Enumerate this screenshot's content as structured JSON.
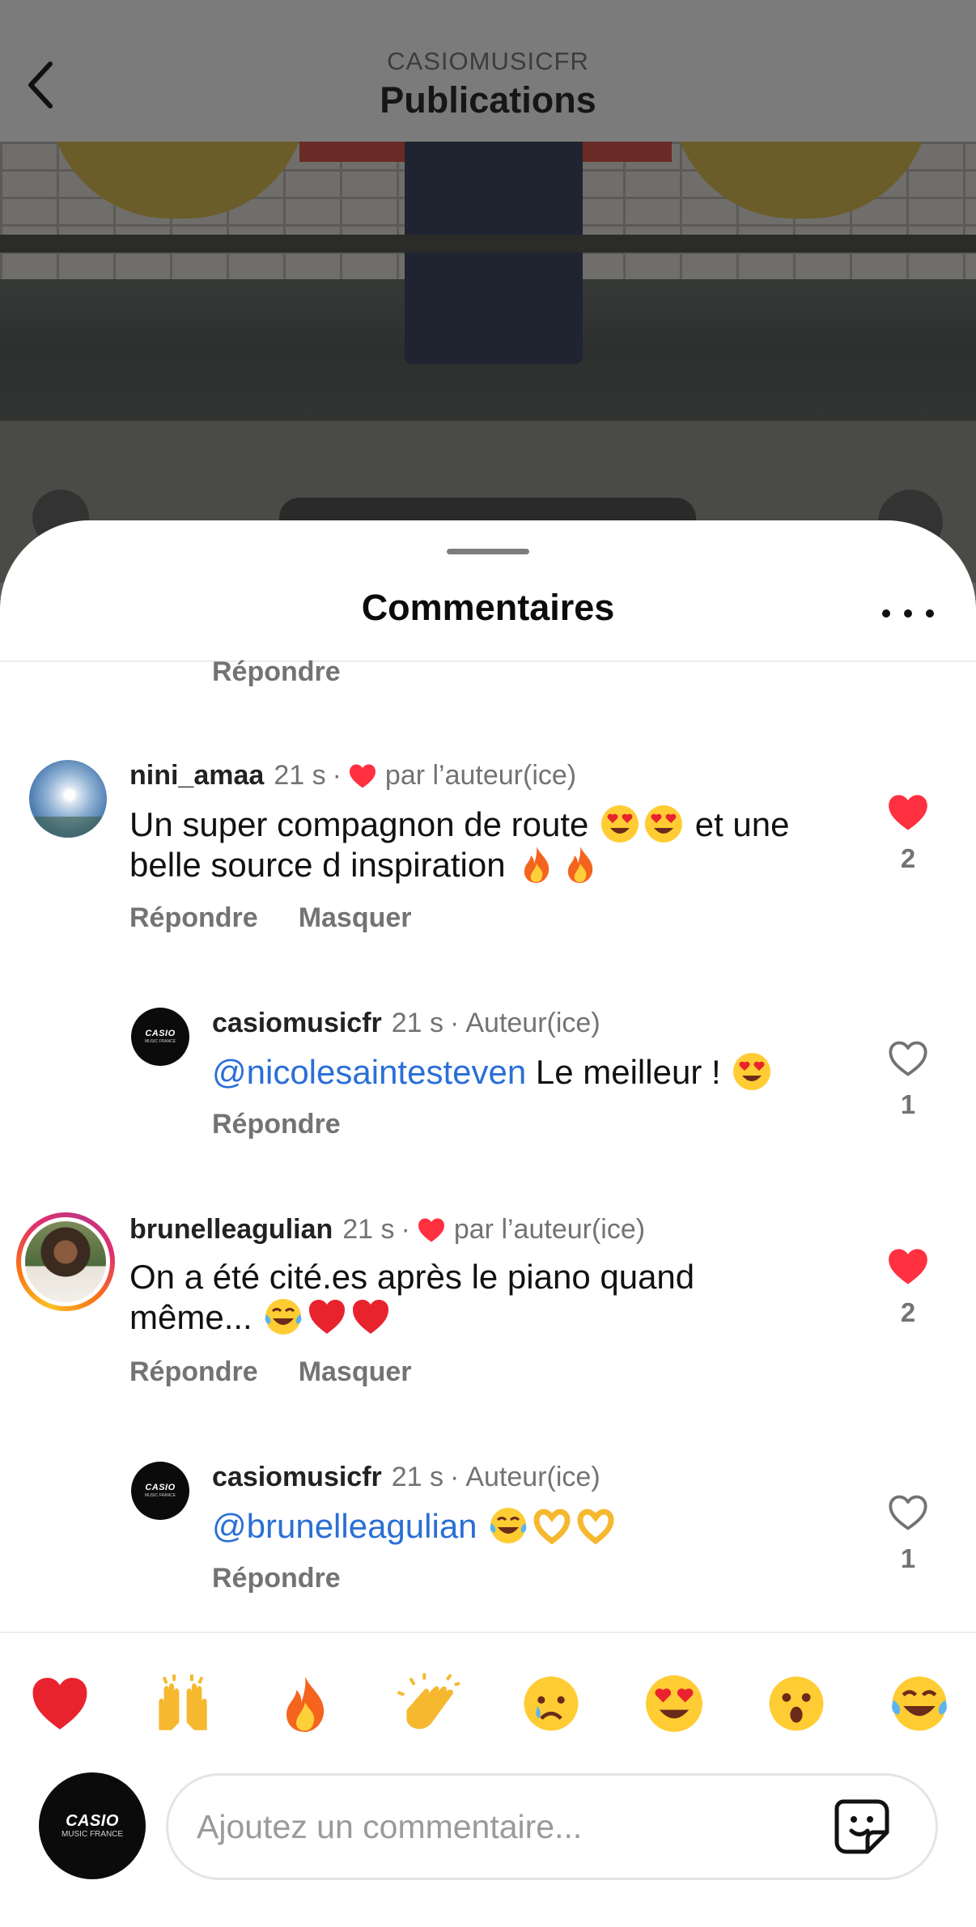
{
  "header": {
    "account": "CASIOMUSICFR",
    "title": "Publications"
  },
  "sheet": {
    "title": "Commentaires",
    "truncated_reply_label": "Répondre"
  },
  "comments": [
    {
      "username": "nini_amaa",
      "time": "21 s",
      "liked_by_author_label": "par l’auteur(ice)",
      "text_line1": "Un super compagnon de route",
      "text_line1_after": "et une",
      "text_line2": "belle source d inspiration",
      "reply_label": "Répondre",
      "hide_label": "Masquer",
      "like_count": "2",
      "liked": true
    },
    {
      "username": "casiomusicfr",
      "time": "21 s",
      "author_label": "Auteur(ice)",
      "mention": "@nicolesaintesteven",
      "text": "Le meilleur !",
      "reply_label": "Répondre",
      "like_count": "1",
      "liked": false
    },
    {
      "username": "brunelleagulian",
      "time": "21 s",
      "liked_by_author_label": "par l’auteur(ice)",
      "text_line1": "On a été cité.es après le piano quand",
      "text_line2": "même...",
      "reply_label": "Répondre",
      "hide_label": "Masquer",
      "like_count": "2",
      "liked": true
    },
    {
      "username": "casiomusicfr",
      "time": "21 s",
      "author_label": "Auteur(ice)",
      "mention": "@brunelleagulian",
      "reply_label": "Répondre",
      "like_count": "1",
      "liked": false
    }
  ],
  "logo": {
    "line1": "CASIO",
    "line2": "MUSIC FRANCE"
  },
  "quick_reactions": [
    "heart-emoji",
    "raising-hands-emoji",
    "fire-emoji",
    "clapping-hands-emoji",
    "crying-face-emoji",
    "heart-eyes-emoji",
    "surprised-face-emoji",
    "tears-of-joy-emoji"
  ],
  "composer": {
    "placeholder": "Ajoutez un commentaire..."
  },
  "colors": {
    "like_red": "#ff3040",
    "mention_blue": "#2a6fd6",
    "secondary_text": "#737373"
  }
}
